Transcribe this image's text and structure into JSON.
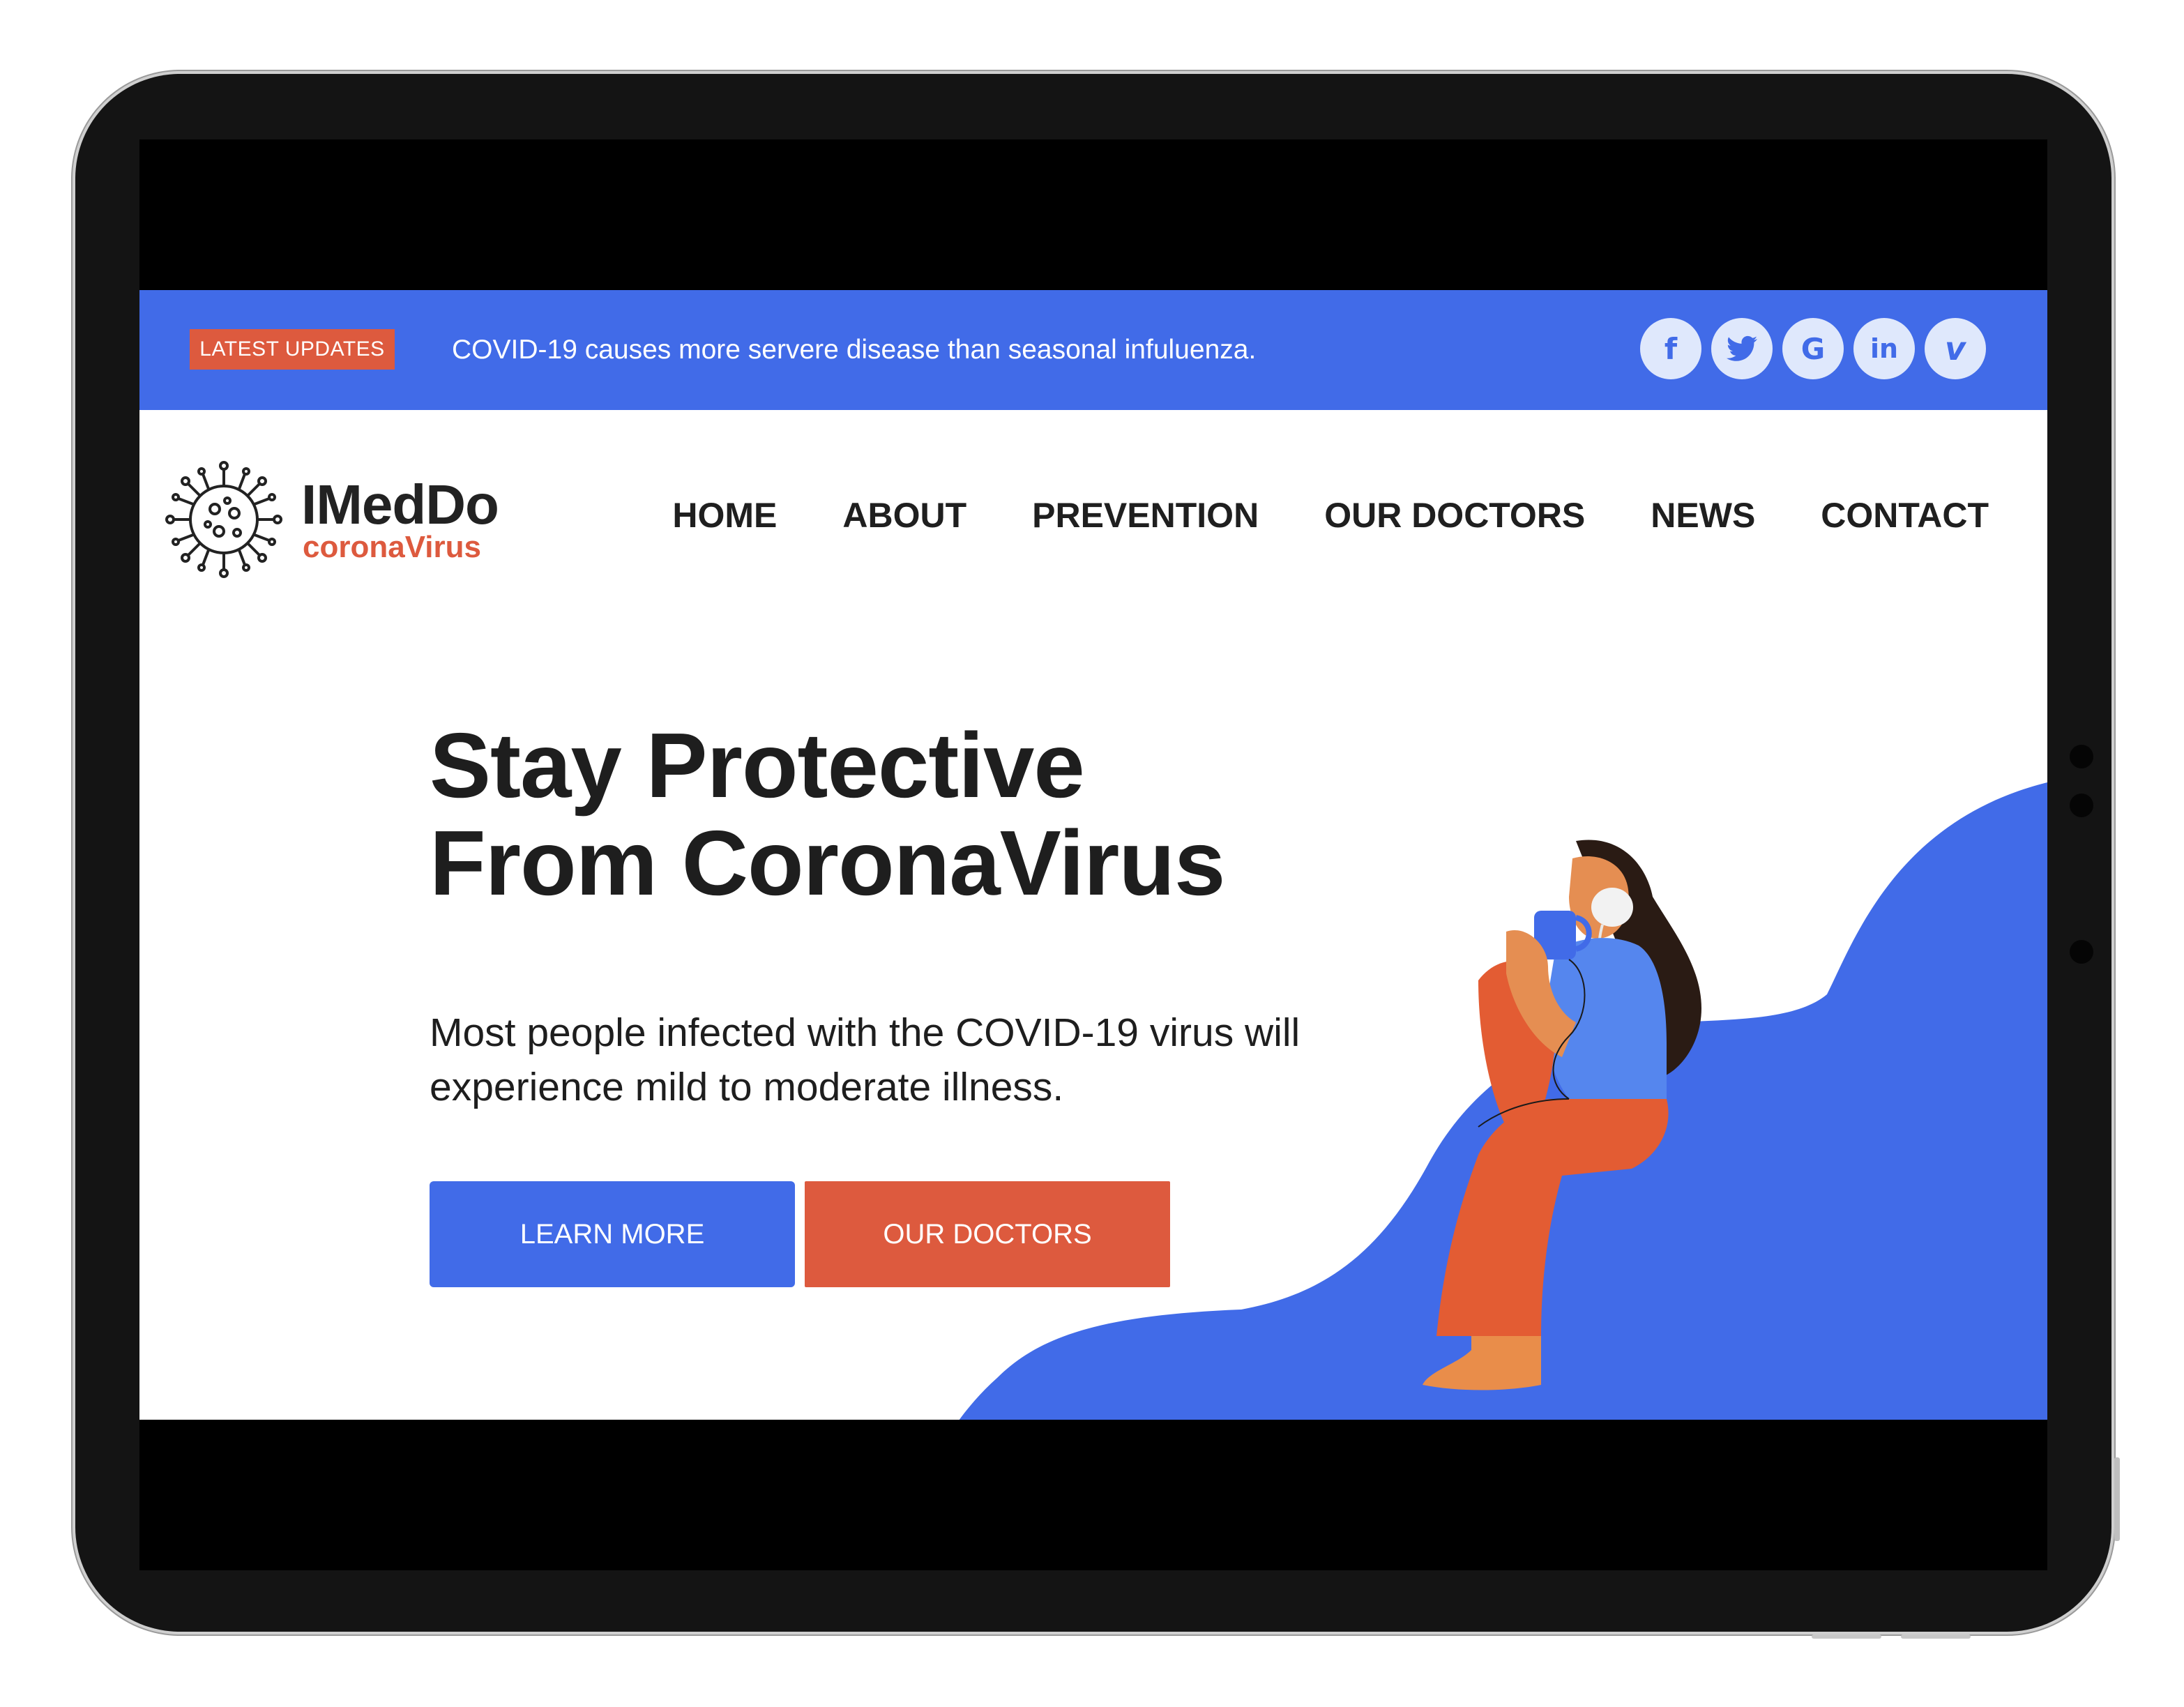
{
  "topbar": {
    "badge": "LATEST UPDATES",
    "ticker": "COVID-19 causes more servere disease than seasonal infuluenza.",
    "socials": [
      {
        "icon": "facebook-icon",
        "glyph": "f"
      },
      {
        "icon": "twitter-icon",
        "glyph": "🐦"
      },
      {
        "icon": "google-icon",
        "glyph": "G"
      },
      {
        "icon": "linkedin-icon",
        "glyph": "in"
      },
      {
        "icon": "vimeo-icon",
        "glyph": "v"
      }
    ]
  },
  "brand": {
    "name": "IMedDo",
    "subtitle": "coronaVirus",
    "logo_icon": "virus-icon"
  },
  "nav": [
    "HOME",
    "ABOUT",
    "PREVENTION",
    "OUR DOCTORS",
    "NEWS",
    "CONTACT"
  ],
  "hero": {
    "title_line1": "Stay Protective",
    "title_line2": "From CoronaVirus",
    "lead": "Most people infected with the COVID-19 virus will experience mild to moderate illness.",
    "btn_primary": "LEARN MORE",
    "btn_secondary": "OUR DOCTORS"
  },
  "colors": {
    "accent_blue": "#416be8",
    "accent_orange": "#dd5a3e",
    "text_dark": "#1e1e1e"
  }
}
